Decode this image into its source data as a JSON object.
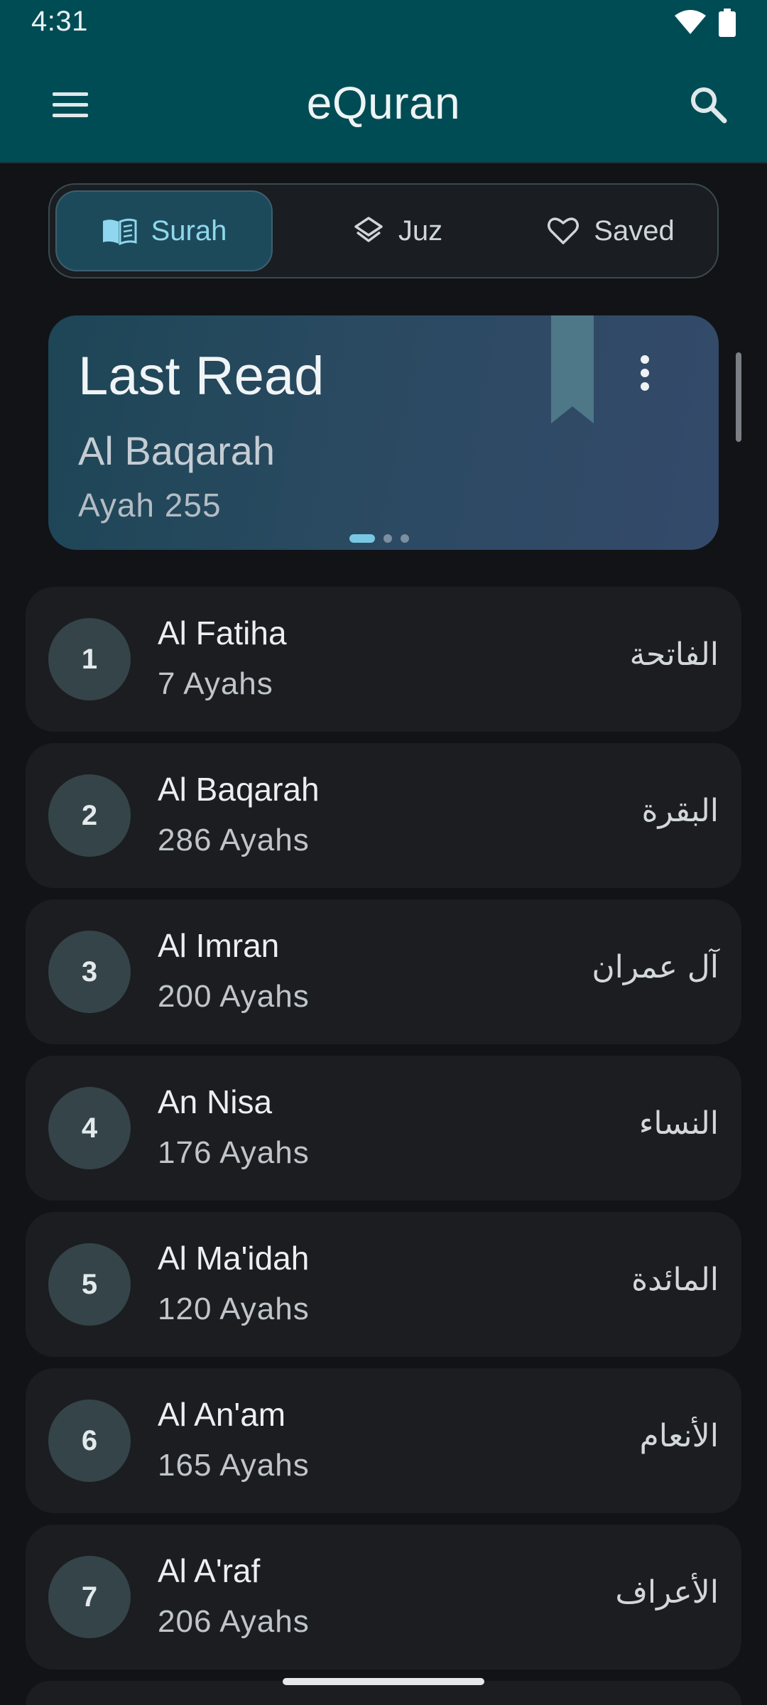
{
  "status_bar": {
    "time": "4:31"
  },
  "app_bar": {
    "title": "eQuran"
  },
  "tabs": [
    {
      "label": "Surah",
      "active": true
    },
    {
      "label": "Juz",
      "active": false
    },
    {
      "label": "Saved",
      "active": false
    }
  ],
  "last_read": {
    "title": "Last Read",
    "surah": "Al Baqarah",
    "ayah": "Ayah 255"
  },
  "surahs": [
    {
      "number": "1",
      "name": "Al Fatiha",
      "ayahs": "7 Ayahs",
      "arabic": "الفاتحة"
    },
    {
      "number": "2",
      "name": "Al Baqarah",
      "ayahs": "286 Ayahs",
      "arabic": "البقرة"
    },
    {
      "number": "3",
      "name": "Al Imran",
      "ayahs": "200 Ayahs",
      "arabic": "آل عمران"
    },
    {
      "number": "4",
      "name": "An Nisa",
      "ayahs": "176 Ayahs",
      "arabic": "النساء"
    },
    {
      "number": "5",
      "name": "Al Ma'idah",
      "ayahs": "120 Ayahs",
      "arabic": "المائدة"
    },
    {
      "number": "6",
      "name": "Al An'am",
      "ayahs": "165 Ayahs",
      "arabic": "الأنعام"
    },
    {
      "number": "7",
      "name": "Al A'raf",
      "ayahs": "206 Ayahs",
      "arabic": "الأعراف"
    }
  ],
  "colors": {
    "app_bar": "#004c55",
    "background": "#111316",
    "accent": "#8fd7ee",
    "row": "#1b1d21"
  }
}
